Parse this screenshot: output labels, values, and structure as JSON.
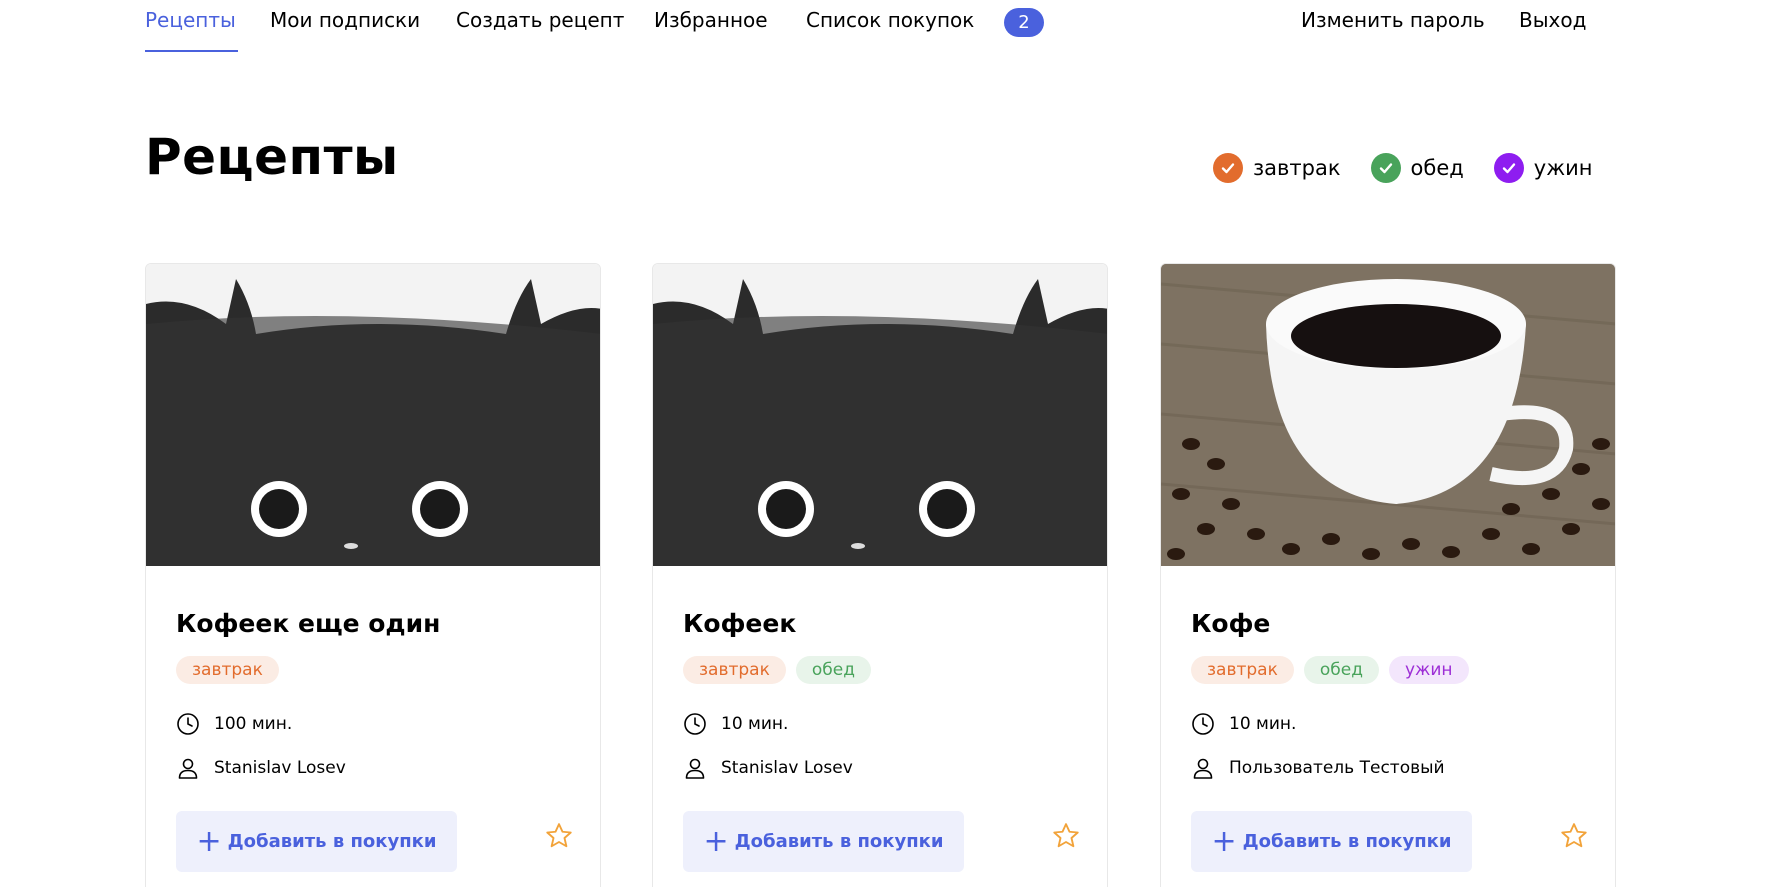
{
  "nav": {
    "items": [
      {
        "label": "Рецепты",
        "active": true
      },
      {
        "label": "Мои подписки"
      },
      {
        "label": "Создать рецепт"
      },
      {
        "label": "Избранное"
      },
      {
        "label": "Список покупок"
      }
    ],
    "cart_count": "2",
    "right": [
      {
        "label": "Изменить пароль"
      },
      {
        "label": "Выход"
      }
    ]
  },
  "page": {
    "title": "Рецепты"
  },
  "filters": [
    {
      "label": "завтрак",
      "color": "#e26c2d",
      "checked": true
    },
    {
      "label": "обед",
      "color": "#49a35b",
      "checked": true
    },
    {
      "label": "ужин",
      "color": "#8e1df0",
      "checked": true
    }
  ],
  "cards": [
    {
      "title": "Кофеек еще один",
      "image": "black-fluffy-creature",
      "tags": [
        "завтрак"
      ],
      "time": "100 мин.",
      "author": "Stanislav Losev",
      "add_label": "Добавить в покупки"
    },
    {
      "title": "Кофеек",
      "image": "black-fluffy-creature",
      "tags": [
        "завтрак",
        "обед"
      ],
      "time": "10 мин.",
      "author": "Stanislav Losev",
      "add_label": "Добавить в покупки"
    },
    {
      "title": "Кофе",
      "image": "coffee-cup-with-beans",
      "tags": [
        "завтрак",
        "обед",
        "ужин"
      ],
      "time": "10 мин.",
      "author": "Пользователь Тестовый",
      "add_label": "Добавить в покупки"
    }
  ],
  "colors": {
    "accent": "#4a61dd",
    "breakfast": "#e26c2d",
    "lunch": "#49a35b",
    "dinner": "#8e1df0",
    "star": "#f2a33a"
  }
}
